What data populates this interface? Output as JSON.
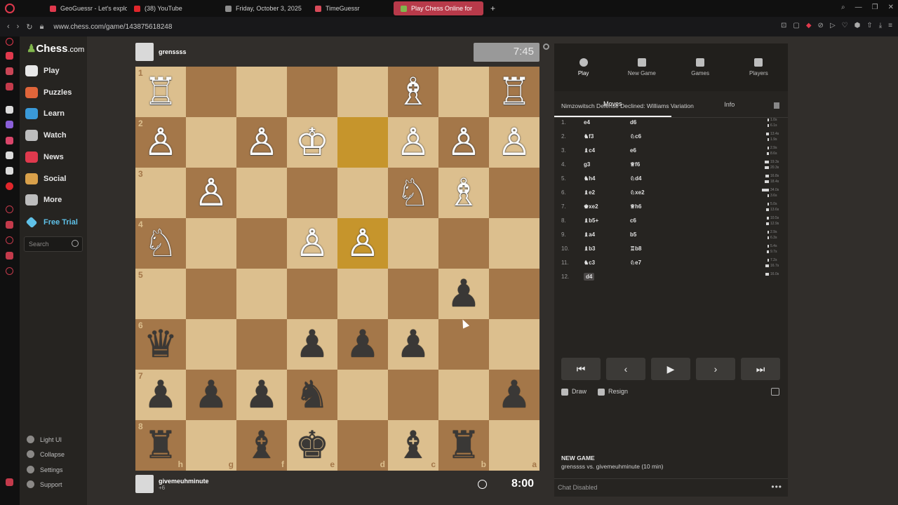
{
  "browser": {
    "tabs": [
      {
        "label": "GeoGuessr - Let's explore",
        "color": "#e0394d"
      },
      {
        "label": "(38) YouTube",
        "color": "#e0262b"
      },
      {
        "label": "Friday, October 3, 2025",
        "color": "#8d8d8d"
      },
      {
        "label": "TimeGuessr",
        "color": "#d94b5a"
      },
      {
        "label": "Play Chess Online for",
        "color": "#81b64c"
      }
    ],
    "new_tab": "+",
    "url": "www.chess.com/game/143875618248"
  },
  "sidebar": {
    "logo_main": "Chess",
    "logo_suffix": ".com",
    "items": [
      {
        "label": "Play",
        "icon": "play-icon",
        "color": "#e8e8e8"
      },
      {
        "label": "Puzzles",
        "icon": "puzzle-icon",
        "color": "#e0653a"
      },
      {
        "label": "Learn",
        "icon": "learn-icon",
        "color": "#3a9ad9"
      },
      {
        "label": "Watch",
        "icon": "watch-icon",
        "color": "#bdbdbd"
      },
      {
        "label": "News",
        "icon": "news-icon",
        "color": "#e0394d"
      },
      {
        "label": "Social",
        "icon": "social-icon",
        "color": "#d9a04a"
      },
      {
        "label": "More",
        "icon": "more-icon",
        "color": "#bdbdbd"
      }
    ],
    "free_trial": "Free Trial",
    "search_placeholder": "Search",
    "bottom_items": [
      "Light UI",
      "Collapse",
      "Settings",
      "Support"
    ]
  },
  "game": {
    "top_player": {
      "name": "grenssss",
      "extra": "",
      "clock": "7:45"
    },
    "bottom_player": {
      "name": "givemeuhminute",
      "extra": "+6",
      "clock": "8:00"
    },
    "board": {
      "files_bottom": [
        "h",
        "g",
        "f",
        "e",
        "d",
        "c",
        "b",
        "a"
      ],
      "ranks_left": [
        "1",
        "2",
        "3",
        "4",
        "5",
        "6",
        "7",
        "8"
      ],
      "rows": [
        [
          "wR",
          "",
          "",
          "",
          "",
          "wB",
          "",
          "wR"
        ],
        [
          "wP",
          "",
          "wP",
          "wK",
          "",
          "wP",
          "wP",
          "wP"
        ],
        [
          "",
          "wP",
          "",
          "",
          "",
          "wN",
          "wB",
          ""
        ],
        [
          "wN",
          "",
          "",
          "wP",
          "wP",
          "",
          "",
          ""
        ],
        [
          "",
          "",
          "",
          "",
          "",
          "",
          "bP",
          ""
        ],
        [
          "bQ",
          "",
          "",
          "bP",
          "bP",
          "bP",
          "",
          ""
        ],
        [
          "bP",
          "bP",
          "bP",
          "bN",
          "",
          "",
          "",
          "bP"
        ],
        [
          "bR",
          "",
          "bB",
          "bK",
          "",
          "bB",
          "bR",
          ""
        ]
      ],
      "highlight": [
        [
          1,
          4
        ],
        [
          3,
          4
        ]
      ]
    }
  },
  "panel": {
    "tabs": [
      "Play",
      "New Game",
      "Games",
      "Players"
    ],
    "subtabs": [
      "Moves",
      "Info"
    ],
    "opening": "Nimzowitsch Defense Declined: Williams Variation",
    "moves": [
      {
        "n": "1.",
        "w": "e4",
        "b": "d6",
        "tw": [
          "1.0s",
          0.05
        ],
        "tb": [
          "6.1s",
          0.2
        ]
      },
      {
        "n": "2.",
        "w": "♞f3",
        "b": "♘c6",
        "tw": [
          "13.4s",
          0.45
        ],
        "tb": [
          "1.9s",
          0.07
        ]
      },
      {
        "n": "3.",
        "w": "♝c4",
        "b": "e6",
        "tw": [
          "2.9s",
          0.1
        ],
        "tb": [
          "8.6s",
          0.28
        ]
      },
      {
        "n": "4.",
        "w": "g3",
        "b": "♕f6",
        "tw": [
          "19.3s",
          0.6
        ],
        "tb": [
          "20.3s",
          0.62
        ]
      },
      {
        "n": "5.",
        "w": "♞h4",
        "b": "♘d4",
        "tw": [
          "16.8s",
          0.52
        ],
        "tb": [
          "18.4s",
          0.57
        ]
      },
      {
        "n": "6.",
        "w": "♝e2",
        "b": "♘xe2",
        "tw": [
          "34.0s",
          1.0
        ],
        "tb": [
          "3.6s",
          0.12
        ]
      },
      {
        "n": "7.",
        "w": "♚xe2",
        "b": "♕h6",
        "tw": [
          "5.0s",
          0.16
        ],
        "tb": [
          "13.6s",
          0.42
        ]
      },
      {
        "n": "8.",
        "w": "♝b5+",
        "b": "c6",
        "tw": [
          "10.5s",
          0.33
        ],
        "tb": [
          "12.9s",
          0.4
        ]
      },
      {
        "n": "9.",
        "w": "♝a4",
        "b": "b5",
        "tw": [
          "2.9s",
          0.1
        ],
        "tb": [
          "6.3s",
          0.2
        ]
      },
      {
        "n": "10.",
        "w": "♝b3",
        "b": "♖b8",
        "tw": [
          "5.4s",
          0.17
        ],
        "tb": [
          "9.7s",
          0.3
        ]
      },
      {
        "n": "11.",
        "w": "♞c3",
        "b": "♘e7",
        "tw": [
          "7.2s",
          0.23
        ],
        "tb": [
          "16.7s",
          0.52
        ]
      },
      {
        "n": "12.",
        "w": "d4",
        "b": "",
        "tw": [
          "16.0s",
          0.5
        ],
        "tb": null
      }
    ],
    "controls": [
      "⏮",
      "‹",
      "▶",
      "›",
      "⏭"
    ],
    "draw": "Draw",
    "resign": "Resign",
    "new_game_title": "NEW GAME",
    "new_game_sub": "grenssss vs. givemeuhminute (10 min)",
    "chat": "Chat Disabled"
  }
}
